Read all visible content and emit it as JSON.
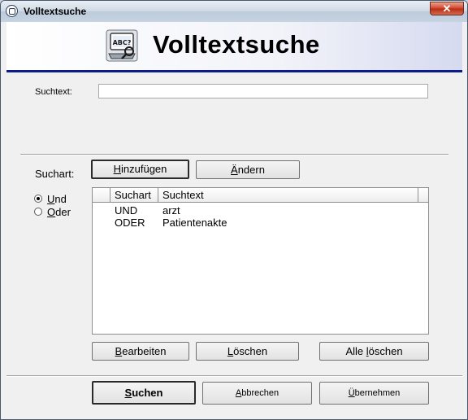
{
  "window": {
    "title": "Volltextsuche",
    "close_glyph": "✕"
  },
  "header": {
    "title": "Volltextsuche",
    "logo_text": "ABC?",
    "logo_icon": "search-computer-icon"
  },
  "search": {
    "label": "Suchtext:",
    "value": ""
  },
  "suchart": {
    "label": "Suchart:",
    "add_button": {
      "prefix": "",
      "accel": "H",
      "rest": "inzufügen"
    },
    "change_button": {
      "prefix": "",
      "accel": "Ä",
      "rest": "ndern"
    },
    "options": [
      {
        "accel": "U",
        "rest": "nd",
        "checked": true
      },
      {
        "accel": "O",
        "rest": "der",
        "checked": false
      }
    ]
  },
  "list": {
    "columns": [
      "",
      "Suchart",
      "Suchtext",
      ""
    ],
    "rows": [
      {
        "suchart": "UND",
        "suchtext": "arzt"
      },
      {
        "suchart": "ODER",
        "suchtext": "Patientenakte"
      }
    ]
  },
  "list_buttons": {
    "edit": {
      "prefix": "",
      "accel": "B",
      "rest": "earbeiten"
    },
    "delete": {
      "prefix": "",
      "accel": "L",
      "rest": "öschen"
    },
    "delete_all": {
      "prefix": "Alle ",
      "accel": "l",
      "rest": "öschen"
    }
  },
  "footer": {
    "search": {
      "accel": "S",
      "rest": "uchen"
    },
    "cancel": {
      "accel": "A",
      "rest": "bbrechen"
    },
    "apply": {
      "accel": "Ü",
      "rest": "bernehmen"
    }
  }
}
